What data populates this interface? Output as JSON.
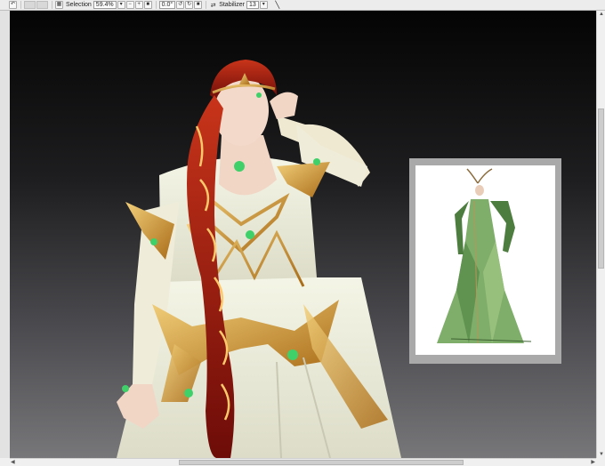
{
  "toolbar": {
    "selection_label": "Selection",
    "zoom": "59.4%",
    "rotation": "0.0°",
    "stabilizer_label": "Stabilizer",
    "stabilizer_value": "13"
  },
  "icons": {
    "undo": "undo-icon",
    "selection": "selection-icon",
    "zoom_minus": "minus-icon",
    "zoom_plus": "plus-icon",
    "stabilizer": "stabilizer-icon",
    "pen": "pen-icon"
  },
  "colors": {
    "canvas_top": "#040404",
    "canvas_bottom": "#77777a",
    "hair": "#a8190d",
    "gown": "#eff0dc",
    "gold": "#d19a2e",
    "gem": "#3fd06a",
    "ref_frame": "#a9a9a9"
  }
}
